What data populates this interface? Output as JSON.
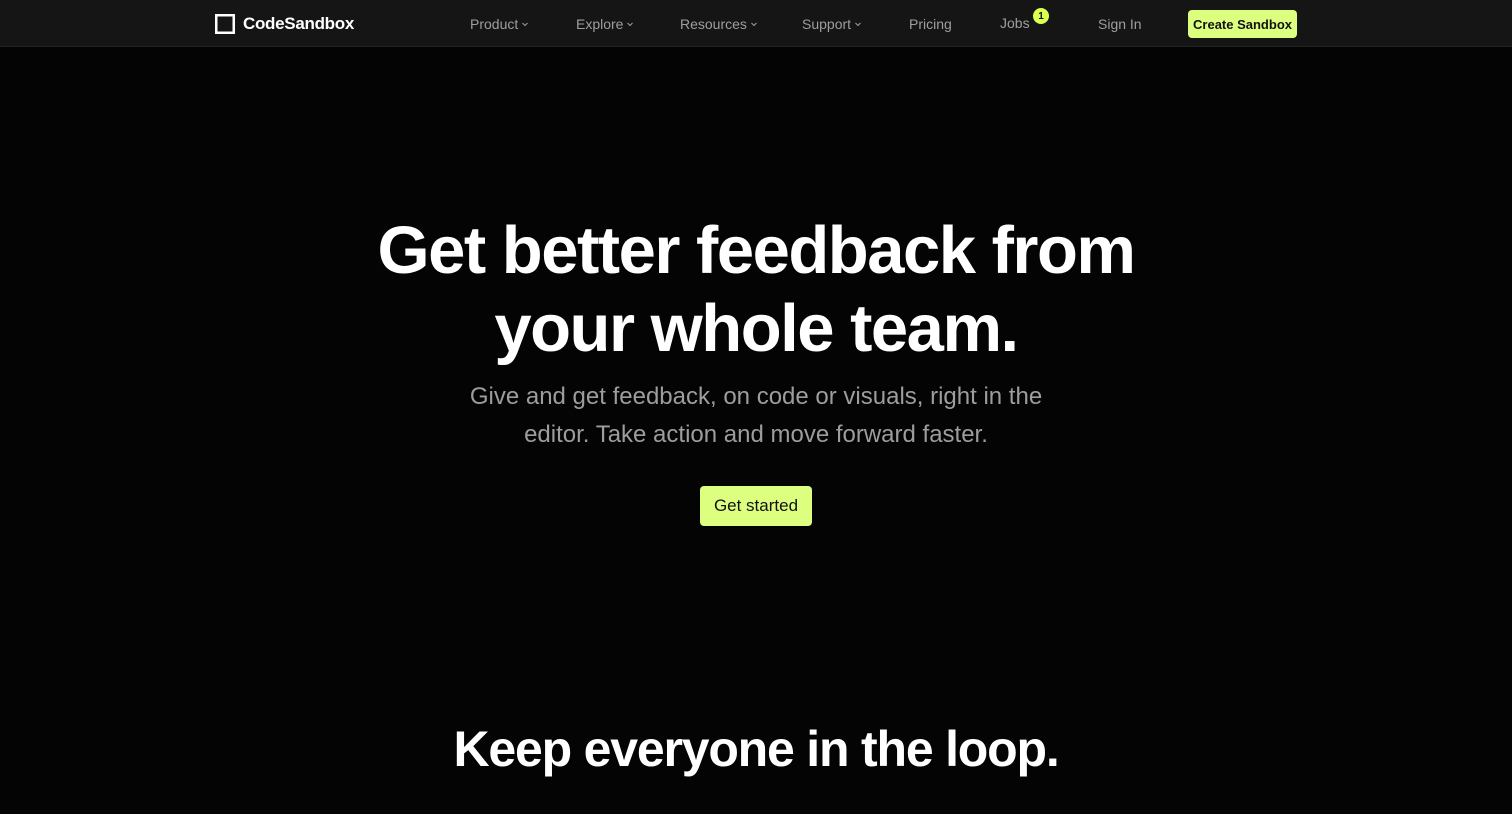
{
  "nav": {
    "logo_text": "CodeSandbox",
    "items": [
      {
        "label": "Product",
        "dropdown": true
      },
      {
        "label": "Explore",
        "dropdown": true
      },
      {
        "label": "Resources",
        "dropdown": true
      },
      {
        "label": "Support",
        "dropdown": true
      },
      {
        "label": "Pricing",
        "dropdown": false
      },
      {
        "label": "Jobs",
        "dropdown": false,
        "badge": "1"
      },
      {
        "label": "Sign In",
        "dropdown": false
      }
    ],
    "cta_label": "Create Sandbox"
  },
  "hero": {
    "title_line1": "Get better feedback from",
    "title_line2": "your whole team.",
    "subtitle_line1": "Give and get feedback, on code or visuals, right in the",
    "subtitle_line2": "editor. Take action and move forward faster.",
    "cta_label": "Get started"
  },
  "section": {
    "title": "Keep everyone in the loop."
  },
  "colors": {
    "background": "#040404",
    "nav_background": "#151515",
    "accent": "#ddff80",
    "muted_text": "#9d9d9d"
  },
  "icons": {
    "logo": "codesandbox-square-logo-icon",
    "dropdown": "chevron-down-icon"
  }
}
